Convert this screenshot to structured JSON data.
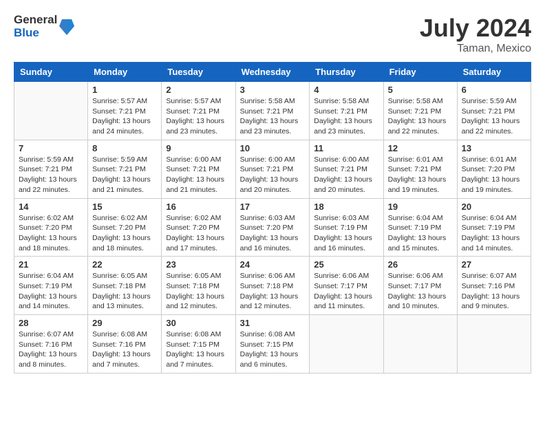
{
  "header": {
    "logo_general": "General",
    "logo_blue": "Blue",
    "month_year": "July 2024",
    "location": "Taman, Mexico"
  },
  "weekdays": [
    "Sunday",
    "Monday",
    "Tuesday",
    "Wednesday",
    "Thursday",
    "Friday",
    "Saturday"
  ],
  "weeks": [
    [
      {
        "day": "",
        "detail": ""
      },
      {
        "day": "1",
        "detail": "Sunrise: 5:57 AM\nSunset: 7:21 PM\nDaylight: 13 hours\nand 24 minutes."
      },
      {
        "day": "2",
        "detail": "Sunrise: 5:57 AM\nSunset: 7:21 PM\nDaylight: 13 hours\nand 23 minutes."
      },
      {
        "day": "3",
        "detail": "Sunrise: 5:58 AM\nSunset: 7:21 PM\nDaylight: 13 hours\nand 23 minutes."
      },
      {
        "day": "4",
        "detail": "Sunrise: 5:58 AM\nSunset: 7:21 PM\nDaylight: 13 hours\nand 23 minutes."
      },
      {
        "day": "5",
        "detail": "Sunrise: 5:58 AM\nSunset: 7:21 PM\nDaylight: 13 hours\nand 22 minutes."
      },
      {
        "day": "6",
        "detail": "Sunrise: 5:59 AM\nSunset: 7:21 PM\nDaylight: 13 hours\nand 22 minutes."
      }
    ],
    [
      {
        "day": "7",
        "detail": "Sunrise: 5:59 AM\nSunset: 7:21 PM\nDaylight: 13 hours\nand 22 minutes."
      },
      {
        "day": "8",
        "detail": "Sunrise: 5:59 AM\nSunset: 7:21 PM\nDaylight: 13 hours\nand 21 minutes."
      },
      {
        "day": "9",
        "detail": "Sunrise: 6:00 AM\nSunset: 7:21 PM\nDaylight: 13 hours\nand 21 minutes."
      },
      {
        "day": "10",
        "detail": "Sunrise: 6:00 AM\nSunset: 7:21 PM\nDaylight: 13 hours\nand 20 minutes."
      },
      {
        "day": "11",
        "detail": "Sunrise: 6:00 AM\nSunset: 7:21 PM\nDaylight: 13 hours\nand 20 minutes."
      },
      {
        "day": "12",
        "detail": "Sunrise: 6:01 AM\nSunset: 7:21 PM\nDaylight: 13 hours\nand 19 minutes."
      },
      {
        "day": "13",
        "detail": "Sunrise: 6:01 AM\nSunset: 7:20 PM\nDaylight: 13 hours\nand 19 minutes."
      }
    ],
    [
      {
        "day": "14",
        "detail": "Sunrise: 6:02 AM\nSunset: 7:20 PM\nDaylight: 13 hours\nand 18 minutes."
      },
      {
        "day": "15",
        "detail": "Sunrise: 6:02 AM\nSunset: 7:20 PM\nDaylight: 13 hours\nand 18 minutes."
      },
      {
        "day": "16",
        "detail": "Sunrise: 6:02 AM\nSunset: 7:20 PM\nDaylight: 13 hours\nand 17 minutes."
      },
      {
        "day": "17",
        "detail": "Sunrise: 6:03 AM\nSunset: 7:20 PM\nDaylight: 13 hours\nand 16 minutes."
      },
      {
        "day": "18",
        "detail": "Sunrise: 6:03 AM\nSunset: 7:19 PM\nDaylight: 13 hours\nand 16 minutes."
      },
      {
        "day": "19",
        "detail": "Sunrise: 6:04 AM\nSunset: 7:19 PM\nDaylight: 13 hours\nand 15 minutes."
      },
      {
        "day": "20",
        "detail": "Sunrise: 6:04 AM\nSunset: 7:19 PM\nDaylight: 13 hours\nand 14 minutes."
      }
    ],
    [
      {
        "day": "21",
        "detail": "Sunrise: 6:04 AM\nSunset: 7:19 PM\nDaylight: 13 hours\nand 14 minutes."
      },
      {
        "day": "22",
        "detail": "Sunrise: 6:05 AM\nSunset: 7:18 PM\nDaylight: 13 hours\nand 13 minutes."
      },
      {
        "day": "23",
        "detail": "Sunrise: 6:05 AM\nSunset: 7:18 PM\nDaylight: 13 hours\nand 12 minutes."
      },
      {
        "day": "24",
        "detail": "Sunrise: 6:06 AM\nSunset: 7:18 PM\nDaylight: 13 hours\nand 12 minutes."
      },
      {
        "day": "25",
        "detail": "Sunrise: 6:06 AM\nSunset: 7:17 PM\nDaylight: 13 hours\nand 11 minutes."
      },
      {
        "day": "26",
        "detail": "Sunrise: 6:06 AM\nSunset: 7:17 PM\nDaylight: 13 hours\nand 10 minutes."
      },
      {
        "day": "27",
        "detail": "Sunrise: 6:07 AM\nSunset: 7:16 PM\nDaylight: 13 hours\nand 9 minutes."
      }
    ],
    [
      {
        "day": "28",
        "detail": "Sunrise: 6:07 AM\nSunset: 7:16 PM\nDaylight: 13 hours\nand 8 minutes."
      },
      {
        "day": "29",
        "detail": "Sunrise: 6:08 AM\nSunset: 7:16 PM\nDaylight: 13 hours\nand 7 minutes."
      },
      {
        "day": "30",
        "detail": "Sunrise: 6:08 AM\nSunset: 7:15 PM\nDaylight: 13 hours\nand 7 minutes."
      },
      {
        "day": "31",
        "detail": "Sunrise: 6:08 AM\nSunset: 7:15 PM\nDaylight: 13 hours\nand 6 minutes."
      },
      {
        "day": "",
        "detail": ""
      },
      {
        "day": "",
        "detail": ""
      },
      {
        "day": "",
        "detail": ""
      }
    ]
  ]
}
